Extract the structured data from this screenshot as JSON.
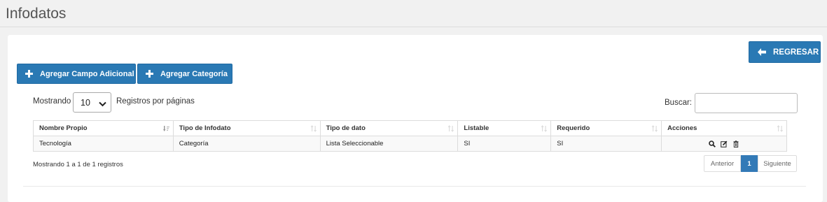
{
  "page": {
    "title": "Infodatos"
  },
  "toolbar": {
    "back_label": "REGRESAR",
    "add_field_label": "Agregar Campo Adicional",
    "add_category_label": "Agregar Categoría"
  },
  "length": {
    "prefix": "Mostrando",
    "value": "10",
    "suffix": "Registros por páginas"
  },
  "search": {
    "label": "Buscar:",
    "value": ""
  },
  "table": {
    "columns": [
      "Nombre Propio",
      "Tipo de Infodato",
      "Tipo de dato",
      "Listable",
      "Requerido",
      "Acciones"
    ],
    "rows": [
      [
        "Tecnología",
        "Categoría",
        "Lista Seleccionable",
        "SI",
        "SI"
      ]
    ]
  },
  "info": "Mostrando 1 a 1 de 1 registros",
  "pagination": {
    "prev": "Anterior",
    "current": "1",
    "next": "Siguiente"
  },
  "colors": {
    "primary": "#2a79b4",
    "pager_active": "#337ab7",
    "background": "#f1f1f1"
  }
}
